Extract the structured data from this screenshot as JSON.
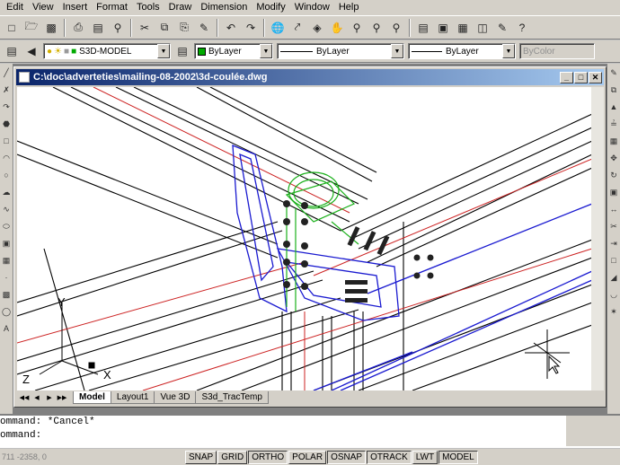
{
  "menu": [
    "Edit",
    "View",
    "Insert",
    "Format",
    "Tools",
    "Draw",
    "Dimension",
    "Modify",
    "Window",
    "Help"
  ],
  "toolbar_icons": [
    "new-icon",
    "open-icon",
    "save-icon",
    "print-icon",
    "preview-icon",
    "find-icon",
    "cut-icon",
    "copy-icon",
    "paste-icon",
    "match-properties-icon",
    "undo-icon",
    "redo-icon",
    "hyperlink-icon",
    "pan-icon",
    "zoom-icon",
    "3dorbit-icon",
    "properties-icon",
    "designcenter-icon",
    "toolpalette-icon",
    "help-icon"
  ],
  "layer": {
    "name": "S3D-MODEL"
  },
  "properties": {
    "color": "ByLayer",
    "linetype": "ByLayer",
    "lineweight": "ByLayer",
    "plotstyle": "ByColor"
  },
  "document": {
    "title": "C:\\doc\\adverteties\\mailing-08-2002\\3d-coulée.dwg"
  },
  "tabs": [
    "Model",
    "Layout1",
    "Vue 3D",
    "S3d_TracTemp"
  ],
  "active_tab": "Model",
  "ucs": {
    "x_label": "X",
    "y_label": "Y",
    "z_label": "Z"
  },
  "command_history": [
    "ommand: *Cancel*",
    "ommand:"
  ],
  "status": {
    "coords": "711 -2358, 0",
    "toggles": [
      "SNAP",
      "GRID",
      "ORTHO",
      "POLAR",
      "OSNAP",
      "OTRACK",
      "LWT",
      "MODEL"
    ]
  },
  "colors": {
    "title_start": "#0a246a",
    "title_end": "#a6caf0",
    "line_black": "#000000",
    "line_red": "#cc2222",
    "line_blue": "#1a1ad0",
    "line_green": "#1ab01a"
  }
}
